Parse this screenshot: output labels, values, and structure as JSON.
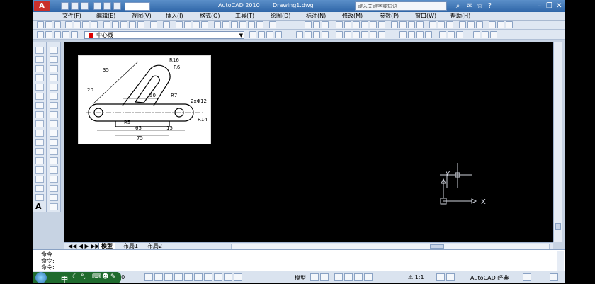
{
  "window": {
    "app_title": "AutoCAD 2010",
    "file_title": "Drawing1.dwg",
    "search_placeholder": "键入关键字或短语",
    "workspace": "",
    "logo": "A"
  },
  "menu": {
    "items": [
      "文件(F)",
      "编辑(E)",
      "视图(V)",
      "插入(I)",
      "格式(O)",
      "工具(T)",
      "绘图(D)",
      "标注(N)",
      "修改(M)",
      "参数(P)",
      "窗口(W)",
      "帮助(H)"
    ]
  },
  "layer_toolbar": {
    "current_layer": "中心线",
    "layer_color": "#dd0000"
  },
  "left_toolbar": {
    "text_tool_label": "A"
  },
  "layout_tabs": [
    "模型",
    "布局1",
    "布局2"
  ],
  "command": {
    "prompt_lines": [
      "命令:",
      "命令:",
      "命令:"
    ]
  },
  "status": {
    "coords": "00",
    "model_label": "模型",
    "scale_label": "1:1",
    "workspace_label": "AutoCAD 经典"
  },
  "taskbar": {
    "ime": "中"
  },
  "reference_drawing": {
    "dims": [
      "35",
      "R16",
      "R6",
      "20",
      "R7",
      "50",
      "2xΦ12",
      "R14",
      "R5",
      "65",
      "15",
      "75"
    ]
  },
  "ucs": {
    "y_label": "Y",
    "x_label": "X"
  }
}
